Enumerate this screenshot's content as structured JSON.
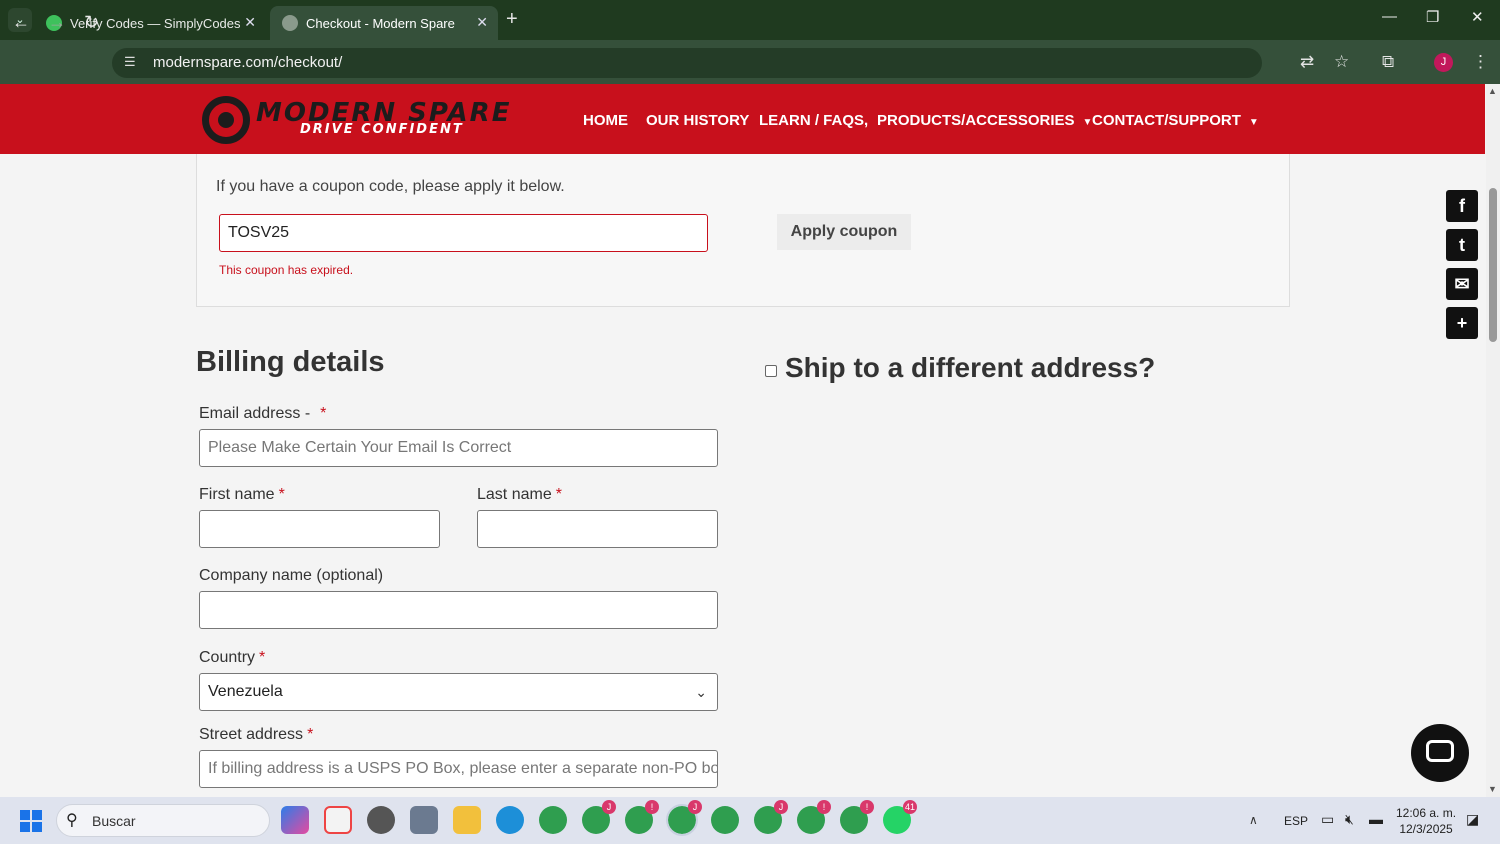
{
  "browser": {
    "tabs": [
      {
        "title": "Verify Codes — SimplyCodes",
        "icon": "simplycodes-icon"
      },
      {
        "title": "Checkout - Modern Spare",
        "icon": "globe-icon"
      }
    ],
    "url": "modernspare.com/checkout/",
    "profile_initial": "J"
  },
  "site": {
    "logo_title": "MODERN SPARE",
    "logo_tagline": "DRIVE CONFIDENT",
    "menu": [
      "HOME",
      "OUR HISTORY",
      "LEARN / FAQS,",
      "PRODUCTS/ACCESSORIES",
      "CONTACT/SUPPORT"
    ],
    "brand_color": "#c8101c"
  },
  "coupon": {
    "message": "If you have a coupon code, please apply it below.",
    "code": "TOSV25",
    "error": "This coupon has expired.",
    "apply_label": "Apply coupon"
  },
  "billing": {
    "title": "Billing details",
    "email_label": "Email address -",
    "email_placeholder": "Please Make Certain Your Email Is Correct",
    "first_name_label": "First name",
    "last_name_label": "Last name",
    "company_label": "Company name (optional)",
    "country_label": "Country",
    "country_value": "Venezuela",
    "street_label": "Street address",
    "street_placeholder": "If billing address is a USPS PO Box, please enter a separate non-PO box s",
    "required_mark": "*"
  },
  "shipping": {
    "label": "Ship to a different address?",
    "checked": false
  },
  "share": [
    "facebook-icon",
    "twitter-icon",
    "email-icon",
    "share-plus-icon"
  ],
  "taskbar": {
    "search_label": "Buscar",
    "language": "ESP",
    "time": "12:06 a. m.",
    "date": "12/3/2025",
    "badges": [
      "J",
      "!",
      "J",
      "J",
      "!",
      "!",
      "41"
    ]
  }
}
